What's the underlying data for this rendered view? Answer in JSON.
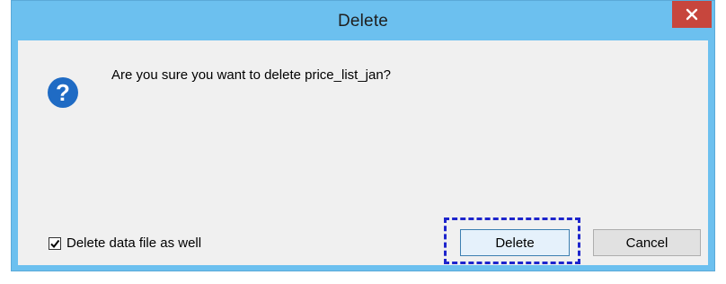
{
  "window": {
    "title": "Delete",
    "titlebar_color": "#6cc0ef",
    "close_button_color": "#c7463d"
  },
  "dialog": {
    "icon": "question-icon",
    "message": "Are you sure you want to delete price_list_jan?",
    "checkbox": {
      "label": "Delete data file as well",
      "checked": true
    },
    "buttons": {
      "delete_label": "Delete",
      "cancel_label": "Cancel"
    }
  }
}
